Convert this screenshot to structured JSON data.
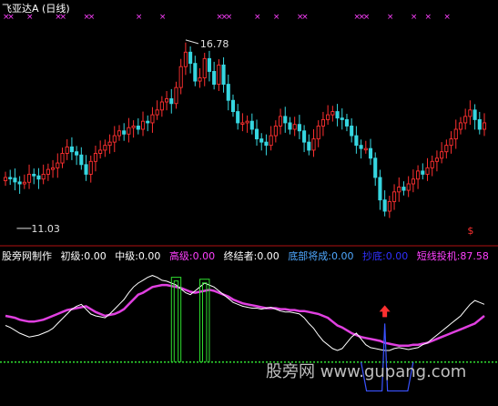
{
  "header": {
    "title": "飞亚达A (日线)"
  },
  "price_panel": {
    "high_label": "16.78",
    "low_label": "11.03",
    "signal_mark": "$"
  },
  "indicator_panel": {
    "name": "股旁网制作",
    "items": [
      {
        "label": "初级:0.00",
        "color": "#ffffff"
      },
      {
        "label": "中级:0.00",
        "color": "#ffffff"
      },
      {
        "label": "高级:0.00",
        "color": "#ff40ff"
      },
      {
        "label": "终结者:0.00",
        "color": "#ffffff"
      },
      {
        "label": "底部将成:0.00",
        "color": "#4fa8ff"
      },
      {
        "label": "抄底:0.00",
        "color": "#3030ff"
      },
      {
        "label": "短线投机:87.58",
        "color": "#ff40ff"
      }
    ]
  },
  "watermark": "股旁网 www.gupang.com",
  "colors": {
    "up": "#ff3030",
    "down": "#36d6e0",
    "white_line": "#ffffff",
    "magenta_line": "#e040e0",
    "green": "#30e030",
    "blue": "#3a52ff",
    "marker": "#ff40ff"
  },
  "chart_data": [
    {
      "type": "candlestick",
      "title": "飞亚达A (日线)",
      "xlabel": "",
      "ylabel": "",
      "ylim": [
        10.6,
        17.4
      ],
      "annotations": [
        {
          "text": "16.78",
          "value": 16.78
        },
        {
          "text": "11.03",
          "value": 11.03
        }
      ],
      "close": [
        12.5,
        12.48,
        12.36,
        12.3,
        12.35,
        12.6,
        12.55,
        12.45,
        12.6,
        12.75,
        12.8,
        12.95,
        13.25,
        13.45,
        13.3,
        13.2,
        12.9,
        12.6,
        13.0,
        13.25,
        13.35,
        13.5,
        13.6,
        13.8,
        13.95,
        13.85,
        14.05,
        14.1,
        14.0,
        14.25,
        14.2,
        14.45,
        14.6,
        14.85,
        14.95,
        14.8,
        15.3,
        15.95,
        16.4,
        16.05,
        15.5,
        15.6,
        16.2,
        15.8,
        15.4,
        16.0,
        15.4,
        14.9,
        14.55,
        14.2,
        14.2,
        14.25,
        14.0,
        13.7,
        13.6,
        13.5,
        13.8,
        14.1,
        14.4,
        14.2,
        14.0,
        14.15,
        13.95,
        13.6,
        13.35,
        13.7,
        14.1,
        14.3,
        14.45,
        14.55,
        14.35,
        14.3,
        14.1,
        13.8,
        13.5,
        13.4,
        13.4,
        13.1,
        12.5,
        11.8,
        11.45,
        11.75,
        12.05,
        12.2,
        12.1,
        12.3,
        12.45,
        12.7,
        12.6,
        12.8,
        13.0,
        13.1,
        13.3,
        13.5,
        13.7,
        14.0,
        14.2,
        14.4,
        14.6,
        14.3,
        14.0,
        14.2
      ],
      "markers_top_indices": [
        0,
        1,
        5,
        11,
        12,
        17,
        18,
        28,
        33,
        45,
        46,
        47,
        53,
        57,
        62,
        63,
        74,
        75,
        76,
        81,
        86,
        89,
        93
      ],
      "signal_index": 98
    },
    {
      "type": "line",
      "series": [
        {
          "name": "",
          "values": [
            48,
            47,
            46,
            44,
            43,
            42,
            42,
            43,
            44,
            46,
            48,
            50,
            52,
            54,
            55,
            56,
            57,
            58,
            55,
            52,
            50,
            48,
            49,
            50,
            52,
            55,
            60,
            65,
            70,
            72,
            75,
            78,
            79,
            80,
            80,
            79,
            78,
            77,
            75,
            73,
            72,
            73,
            74,
            75,
            74,
            72,
            70,
            68,
            65,
            63,
            61,
            60,
            59,
            58,
            57,
            56,
            56,
            56,
            55,
            55,
            54,
            54,
            53,
            53,
            52,
            51,
            50,
            48,
            46,
            42,
            38,
            36,
            33,
            30,
            28,
            26,
            25,
            24,
            23,
            22,
            20,
            19,
            18,
            17,
            17,
            17,
            18,
            18,
            19,
            20,
            22,
            24,
            26,
            28,
            30,
            32,
            34,
            36,
            38,
            40,
            44,
            48
          ]
        },
        {
          "name": "",
          "values": [
            38,
            36,
            33,
            30,
            28,
            26,
            27,
            28,
            30,
            32,
            35,
            40,
            45,
            50,
            55,
            58,
            60,
            55,
            50,
            48,
            47,
            46,
            50,
            55,
            60,
            65,
            72,
            78,
            82,
            85,
            88,
            90,
            88,
            85,
            84,
            82,
            80,
            76,
            72,
            70,
            74,
            78,
            82,
            80,
            78,
            74,
            70,
            66,
            62,
            60,
            58,
            57,
            56,
            56,
            55,
            56,
            57,
            55,
            53,
            52,
            52,
            51,
            50,
            46,
            40,
            35,
            28,
            22,
            18,
            14,
            12,
            14,
            20,
            26,
            30,
            24,
            18,
            15,
            14,
            13,
            12,
            12,
            14,
            15,
            14,
            13,
            14,
            15,
            18,
            20,
            24,
            28,
            32,
            36,
            40,
            44,
            48,
            54,
            60,
            64,
            62,
            60
          ]
        },
        {
          "name": "",
          "values": [
            0,
            0,
            0,
            0,
            0,
            0,
            0,
            0,
            0,
            0,
            0,
            0,
            0,
            0,
            0,
            0,
            0,
            0,
            0,
            0,
            0,
            0,
            0,
            0,
            0,
            0,
            0,
            0,
            0,
            0,
            0,
            0,
            0,
            0,
            0,
            0,
            0,
            0,
            0,
            0,
            0,
            0,
            0,
            0,
            0,
            0,
            0,
            0,
            0,
            0,
            0,
            0,
            0,
            0,
            0,
            0,
            0,
            0,
            0,
            0,
            0,
            0,
            0,
            0,
            0,
            0,
            0,
            0,
            0,
            0,
            0,
            0,
            0,
            0,
            0,
            0,
            0,
            0,
            0,
            0,
            0,
            0,
            0,
            0,
            0,
            0,
            0,
            0,
            0,
            0,
            0,
            0,
            0,
            0,
            0,
            0,
            0,
            0,
            0,
            0,
            0,
            0
          ]
        },
        {
          "name": "",
          "values": [
            0,
            0,
            0,
            0,
            0,
            0,
            0,
            0,
            0,
            0,
            0,
            0,
            0,
            0,
            0,
            0,
            0,
            0,
            0,
            0,
            0,
            0,
            0,
            0,
            0,
            0,
            0,
            0,
            0,
            0,
            0,
            0,
            0,
            0,
            0,
            0,
            0,
            0,
            0,
            0,
            0,
            0,
            0,
            0,
            0,
            0,
            0,
            0,
            0,
            0,
            0,
            0,
            0,
            0,
            0,
            0,
            0,
            0,
            0,
            0,
            0,
            0,
            0,
            0,
            0,
            0,
            0,
            0,
            0,
            0,
            0,
            0,
            0,
            0,
            0,
            0,
            0,
            0,
            0,
            0,
            0,
            0,
            0,
            0,
            0,
            0,
            0,
            0,
            0,
            0,
            0,
            0,
            0,
            0,
            0,
            0,
            0,
            0,
            0,
            0,
            0,
            0
          ]
        }
      ],
      "green_spikes": [
        {
          "start": 35,
          "end": 37,
          "value": 88
        },
        {
          "start": 41,
          "end": 43,
          "value": 86
        }
      ],
      "blue_trough": {
        "start": 75,
        "end": 86,
        "value": -30
      },
      "blue_spike_index": 80,
      "blue_spike_value": 40,
      "arrow_index": 80,
      "ylim": [
        -40,
        100
      ]
    }
  ]
}
